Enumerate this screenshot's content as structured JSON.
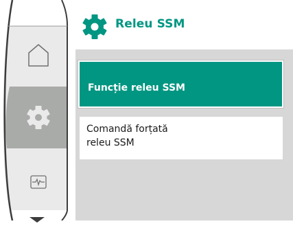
{
  "colors": {
    "accent": "#009682",
    "panel_background": "#d7d7d7",
    "rail_selected": "#a8aba7",
    "rail_outline": "#3c3c3c"
  },
  "nav": {
    "items": [
      {
        "icon": "home-icon",
        "selected": false
      },
      {
        "icon": "gear-icon",
        "selected": true
      },
      {
        "icon": "diagnostics-icon",
        "selected": false
      }
    ],
    "scroll_indicator": "triangle-down-icon"
  },
  "header": {
    "icon": "gear-icon",
    "title": "Releu SSM"
  },
  "menu": {
    "items": [
      {
        "label_lines": [
          "Funcție releu SSM"
        ],
        "selected": true
      },
      {
        "label_lines": [
          "Comandă forțată",
          "releu SSM"
        ],
        "selected": false
      }
    ]
  }
}
